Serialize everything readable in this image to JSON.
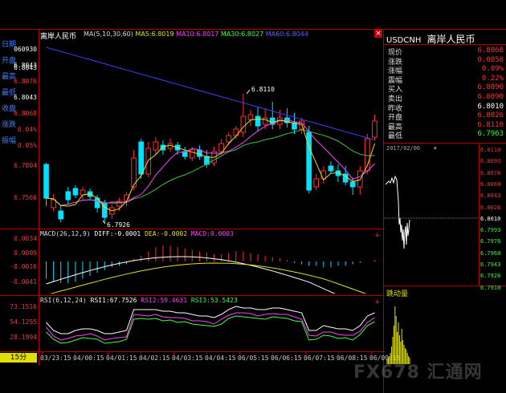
{
  "app": {
    "header_title": "离岸人民币",
    "ma_label": "MA(5,10,30,60)",
    "ma5": "MA5:6.8019",
    "ma10": "MA10:6.8017",
    "ma30": "MA30:6.8027",
    "ma60": "MA60:6.8044",
    "period_button": "15分",
    "close_glyph": "×"
  },
  "left_info": [
    {
      "label": "日期",
      "value": "060930"
    },
    {
      "label": "开盘",
      "value": "6.8043"
    },
    {
      "label": "最高",
      "value": "6.8076"
    },
    {
      "label": "最低",
      "value": "6.8043"
    },
    {
      "label": "收盘",
      "value": "6.8068"
    },
    {
      "label": "涨跌",
      "value": "0.04%"
    },
    {
      "label": "振幅",
      "value": "0.05%"
    }
  ],
  "price_axis": [
    "6.8043",
    "6.7804",
    "6.7566"
  ],
  "annotations": {
    "high": "6.8110",
    "low": "6.7926"
  },
  "macd": {
    "title": "MACD(26,12,9)",
    "diff": "DIFF:-0.0001",
    "dea": "DEA:-0.0002",
    "macd": "MACD:0.0003",
    "axis": [
      "0.0034",
      "0.0009",
      "-0.0016",
      "-0.0041"
    ]
  },
  "rsi": {
    "title": "RSI(6,12,24)",
    "rsi1": "RSI1:67.7526",
    "rsi2": "RSI2:59.4631",
    "rsi3": "RSI3:53.5423",
    "axis": [
      "73.1516",
      "54.1255",
      "28.1994"
    ]
  },
  "x_axis": [
    "03/23:15",
    "04/00:15",
    "04/01:15",
    "04/02:15",
    "04/03:15",
    "04/04:15",
    "06/05:15",
    "06/06:15",
    "06/07:15",
    "06/08:15",
    "06/09:15"
  ],
  "quote": {
    "symbol": "USDCNH",
    "name": "离岸人民币",
    "rows": [
      {
        "k": "现价",
        "v": "6.8068",
        "c": "#ff3030"
      },
      {
        "k": "涨跌",
        "v": "0.0058",
        "c": "#ff3030"
      },
      {
        "k": "涨幅",
        "v": "0.09%",
        "c": "#ff3030"
      },
      {
        "k": "震幅",
        "v": "0.22%",
        "c": "#ff3030"
      },
      {
        "k": "买入",
        "v": "6.8090",
        "c": "#ff3030"
      },
      {
        "k": "卖出",
        "v": "6.8090",
        "c": "#ff3030"
      },
      {
        "k": "昨收",
        "v": "6.8010",
        "c": "#ffffff"
      },
      {
        "k": "开盘",
        "v": "6.8026",
        "c": "#ff3030"
      },
      {
        "k": "最高",
        "v": "6.8110",
        "c": "#ff3030"
      },
      {
        "k": "最低",
        "v": "6.7963",
        "c": "#30ff30"
      }
    ]
  },
  "intraday": {
    "date": "2017/02/06",
    "axis": [
      {
        "v": "6.8110",
        "c": "#ff3030"
      },
      {
        "v": "6.8093",
        "c": "#ff3030"
      },
      {
        "v": "6.8076",
        "c": "#ff3030"
      },
      {
        "v": "6.8060",
        "c": "#ff3030"
      },
      {
        "v": "6.8043",
        "c": "#ff3030"
      },
      {
        "v": "6.8026",
        "c": "#ff3030"
      },
      {
        "v": "6.8010",
        "c": "#ffffff"
      },
      {
        "v": "6.7993",
        "c": "#30ff30"
      },
      {
        "v": "6.7976",
        "c": "#30ff30"
      },
      {
        "v": "6.7960",
        "c": "#30ff30"
      },
      {
        "v": "6.7943",
        "c": "#30ff30"
      },
      {
        "v": "6.7926",
        "c": "#30ff30"
      },
      {
        "v": "6.7910",
        "c": "#30ff30"
      }
    ],
    "volume_label": "跳动量"
  },
  "watermark": "FX678 汇通网",
  "colors": {
    "up": "#ff3030",
    "down": "#00e0ff",
    "ma5": "#ffffff",
    "ma10": "#e0e020",
    "ma30": "#ff40ff",
    "ma60": "#4040ff",
    "grid": "#b00000"
  }
}
